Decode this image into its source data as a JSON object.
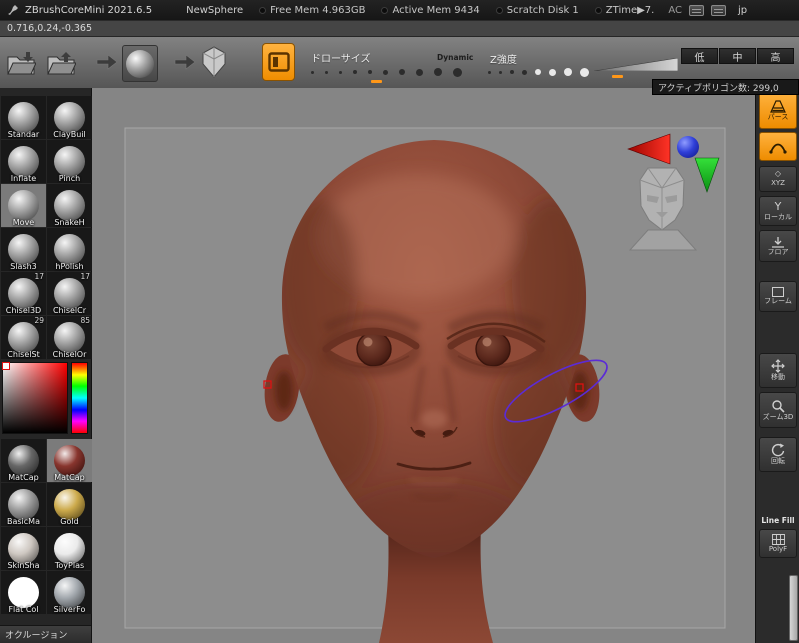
{
  "colors": {
    "accent_orange": "#f79400",
    "canvas_bg": "#858585",
    "head_base": "#8a4736",
    "stroke_purple": "#5b2bd6",
    "marker_red": "#dd1111"
  },
  "titlebar": {
    "app_title": "ZBrushCoreMini 2021.6.5",
    "doc_name": "NewSphere",
    "stat_free_mem": "Free Mem 4.963GB",
    "stat_active_mem": "Active Mem 9434",
    "stat_scratch_disk": "Scratch Disk 1",
    "stat_ztime": "ZTime▶7.",
    "ac_label": "AC",
    "lang_label": "jp"
  },
  "coordbar": {
    "coordinates": "0.716,0.24,-0.365"
  },
  "toolbar": {
    "draw_size_label": "ドローサイズ",
    "dynamic_label": "Dynamic",
    "z_intensity_label": "Z強度",
    "res_low": "低",
    "res_mid": "中",
    "res_high": "高",
    "active_polygons": "アクティブポリゴン数: 299,0"
  },
  "brush_panel": {
    "brushes": [
      {
        "name": "Standar"
      },
      {
        "name": "ClayBuil"
      },
      {
        "name": "Inflate"
      },
      {
        "name": "Pinch"
      },
      {
        "name": "Move"
      },
      {
        "name": "SnakeH"
      },
      {
        "name": "Slash3"
      },
      {
        "name": "hPolish"
      },
      {
        "name": "Chisel3D",
        "badge": "17"
      },
      {
        "name": "ChiselCr",
        "badge": "17"
      },
      {
        "name": "ChiselSt",
        "badge": "29"
      },
      {
        "name": "ChiselOr",
        "badge": "85"
      }
    ]
  },
  "materials": [
    {
      "name": "MatCap",
      "color": "#5a5a5a"
    },
    {
      "name": "MatCap",
      "color": "#7e241c"
    },
    {
      "name": "BasicMa",
      "color": "#929292"
    },
    {
      "name": "Gold",
      "color": "#c8a33c"
    },
    {
      "name": "SkinSha",
      "color": "#cac3bc"
    },
    {
      "name": "ToyPlas",
      "color": "#e9e9e9"
    },
    {
      "name": "Flat Col",
      "color": "#ffffff"
    },
    {
      "name": "SilverFo",
      "color": "#9aa0a6"
    }
  ],
  "occlusion_label": "オクルージョン",
  "right_panel": {
    "perspective_label": "パース",
    "xyz_label": "XYZ",
    "local_label": "ローカル",
    "floor_label": "フロア",
    "frame_label": "フレーム",
    "move_label": "移動",
    "zoom3d_label": "ズーム3D",
    "rotate_label": "回転",
    "line_fill_label": "Line Fill",
    "polyf_label": "PolyF"
  }
}
